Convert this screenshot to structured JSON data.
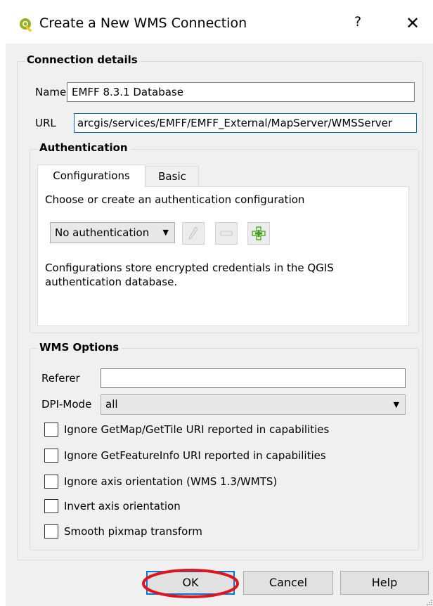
{
  "window": {
    "title": "Create a New WMS Connection",
    "help_label": "?",
    "close_label": "✕",
    "app_icon": "qgis-icon"
  },
  "connection": {
    "legend": "Connection details",
    "name_label": "Name",
    "name_value": "EMFF 8.3.1 Database",
    "url_label": "URL",
    "url_value": "arcgis/services/EMFF/EMFF_External/MapServer/WMSServer"
  },
  "auth": {
    "legend": "Authentication",
    "tabs": [
      {
        "label": "Configurations",
        "active": true
      },
      {
        "label": "Basic",
        "active": false
      }
    ],
    "prompt": "Choose or create an authentication configuration",
    "combo_value": "No authentication",
    "info_line1": "Configurations store encrypted credentials in the QGIS",
    "info_line2": "authentication database.",
    "icons": [
      "pencil-icon",
      "minus-icon",
      "plus-icon"
    ]
  },
  "wms": {
    "legend": "WMS Options",
    "referer_label": "Referer",
    "referer_value": "",
    "dpi_label": "DPI-Mode",
    "dpi_value": "all",
    "options": [
      {
        "label": "Ignore GetMap/GetTile URI reported in capabilities",
        "checked": false
      },
      {
        "label": "Ignore GetFeatureInfo URI reported in capabilities",
        "checked": false
      },
      {
        "label": "Ignore axis orientation (WMS 1.3/WMTS)",
        "checked": false
      },
      {
        "label": "Invert axis orientation",
        "checked": false
      },
      {
        "label": "Smooth pixmap transform",
        "checked": false
      }
    ]
  },
  "buttons": {
    "ok": "OK",
    "cancel": "Cancel",
    "help": "Help"
  },
  "colors": {
    "accent": "#0078d7",
    "annotation": "#e0151b"
  }
}
